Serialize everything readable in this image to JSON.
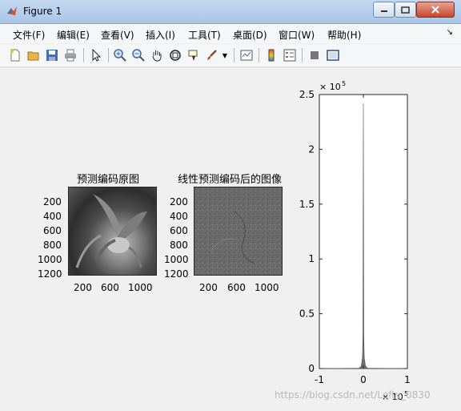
{
  "window": {
    "title": "Figure 1"
  },
  "menu": [
    {
      "label": "文件(F)"
    },
    {
      "label": "编辑(E)"
    },
    {
      "label": "查看(V)"
    },
    {
      "label": "插入(I)"
    },
    {
      "label": "工具(T)"
    },
    {
      "label": "桌面(D)"
    },
    {
      "label": "窗口(W)"
    },
    {
      "label": "帮助(H)"
    }
  ],
  "toolbar": {
    "icons": [
      "new-figure-icon",
      "open-file-icon",
      "save-icon",
      "print-icon",
      "select-arrow-icon",
      "zoom-in-icon",
      "zoom-out-icon",
      "pan-hand-icon",
      "rotate-3d-icon",
      "data-cursor-icon",
      "brush-icon",
      "link-plot-icon",
      "colorbar-icon",
      "legend-icon",
      "hide-plot-tools-icon",
      "show-plot-tools-icon"
    ]
  },
  "plots": {
    "original": {
      "title": "预测编码原图",
      "yticks": [
        "200",
        "400",
        "600",
        "800",
        "1000",
        "1200"
      ],
      "xticks": [
        "200",
        "600",
        "1000"
      ]
    },
    "encoded": {
      "title": "线性预测编码后的图像",
      "yticks": [
        "200",
        "400",
        "600",
        "800",
        "1000",
        "1200"
      ],
      "xticks": [
        "200",
        "600",
        "1000"
      ]
    }
  },
  "chart_data": {
    "type": "area",
    "title": "",
    "xlabel": "",
    "ylabel": "",
    "xlim": [
      -100000,
      100000
    ],
    "ylim": [
      0,
      250000
    ],
    "y_exponent": "× 10^5",
    "x_exponent": "× 10^5",
    "yticks": [
      "0",
      "0.5",
      "1",
      "1.5",
      "2",
      "2.5"
    ],
    "xticks": [
      "-1",
      "0",
      "1"
    ],
    "x": [
      -100000,
      -10000,
      -5000,
      -2000,
      -1000,
      0,
      1000,
      2000,
      5000,
      10000,
      100000
    ],
    "y": [
      0,
      300,
      2000,
      10000,
      30000,
      242000,
      30000,
      10000,
      2000,
      300,
      0
    ]
  },
  "watermark": "https://blog.csdn.net/Lefty_0830"
}
